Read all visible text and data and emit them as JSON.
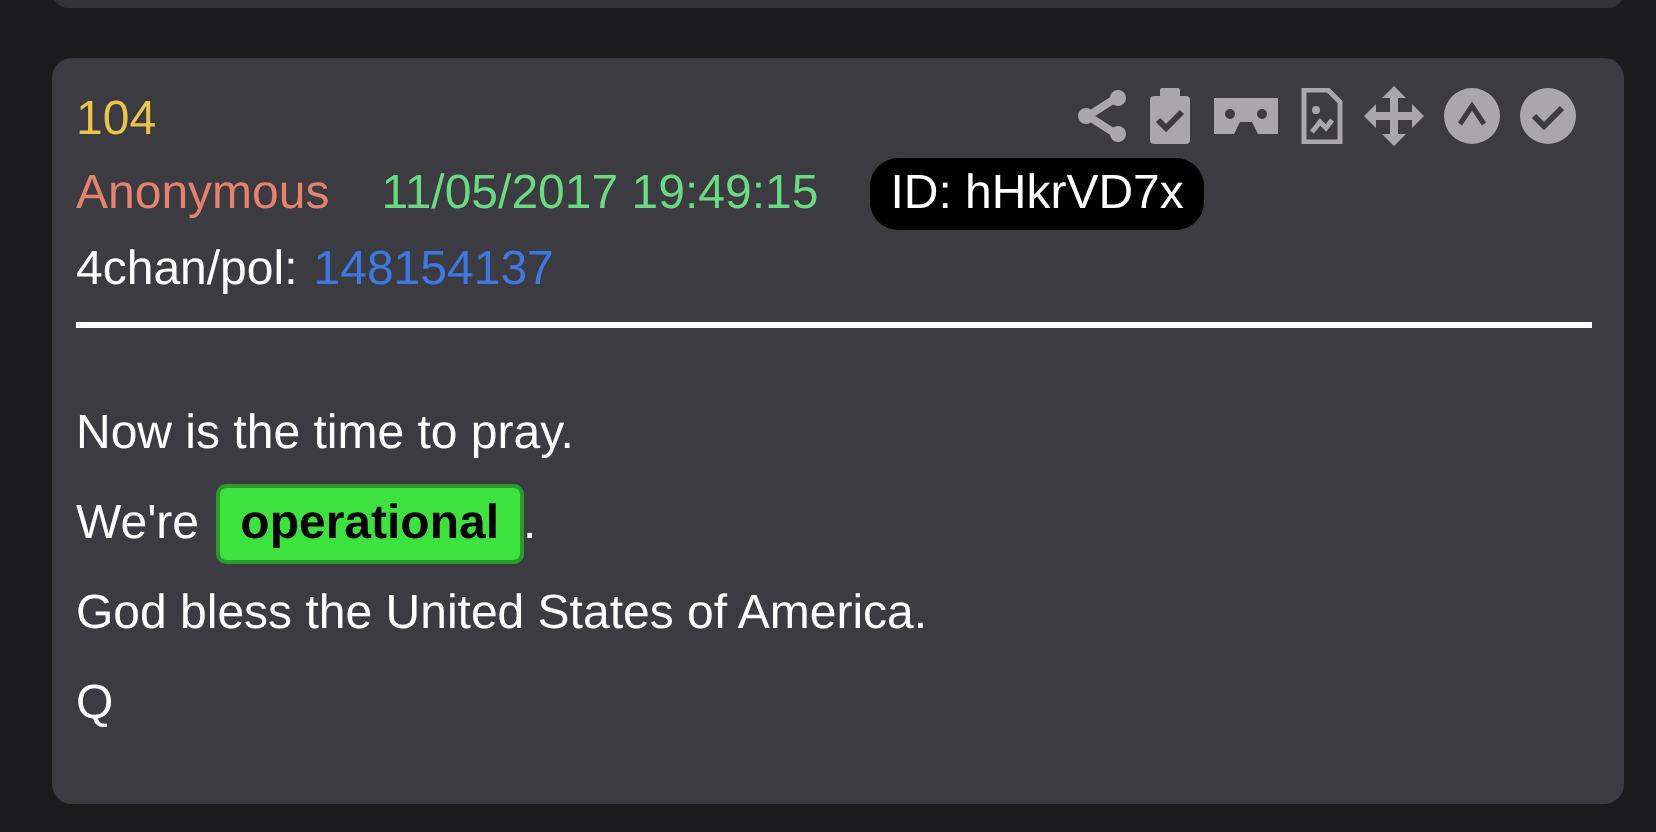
{
  "post": {
    "number": "104",
    "author": "Anonymous",
    "timestamp": "11/05/2017 19:49:15",
    "id": "ID: hHkrVD7x",
    "board": "4chan/pol:",
    "post_link": "148154137",
    "message": [
      [
        {
          "kind": "text",
          "text": "Now is the time to pray."
        }
      ],
      [
        {
          "kind": "text",
          "text": "We're "
        },
        {
          "kind": "highlight",
          "text": "operational"
        },
        {
          "kind": "text",
          "text": "."
        }
      ],
      [
        {
          "kind": "text",
          "text": "God bless the United States of America."
        }
      ],
      [
        {
          "kind": "text",
          "text": "Q"
        }
      ]
    ]
  }
}
